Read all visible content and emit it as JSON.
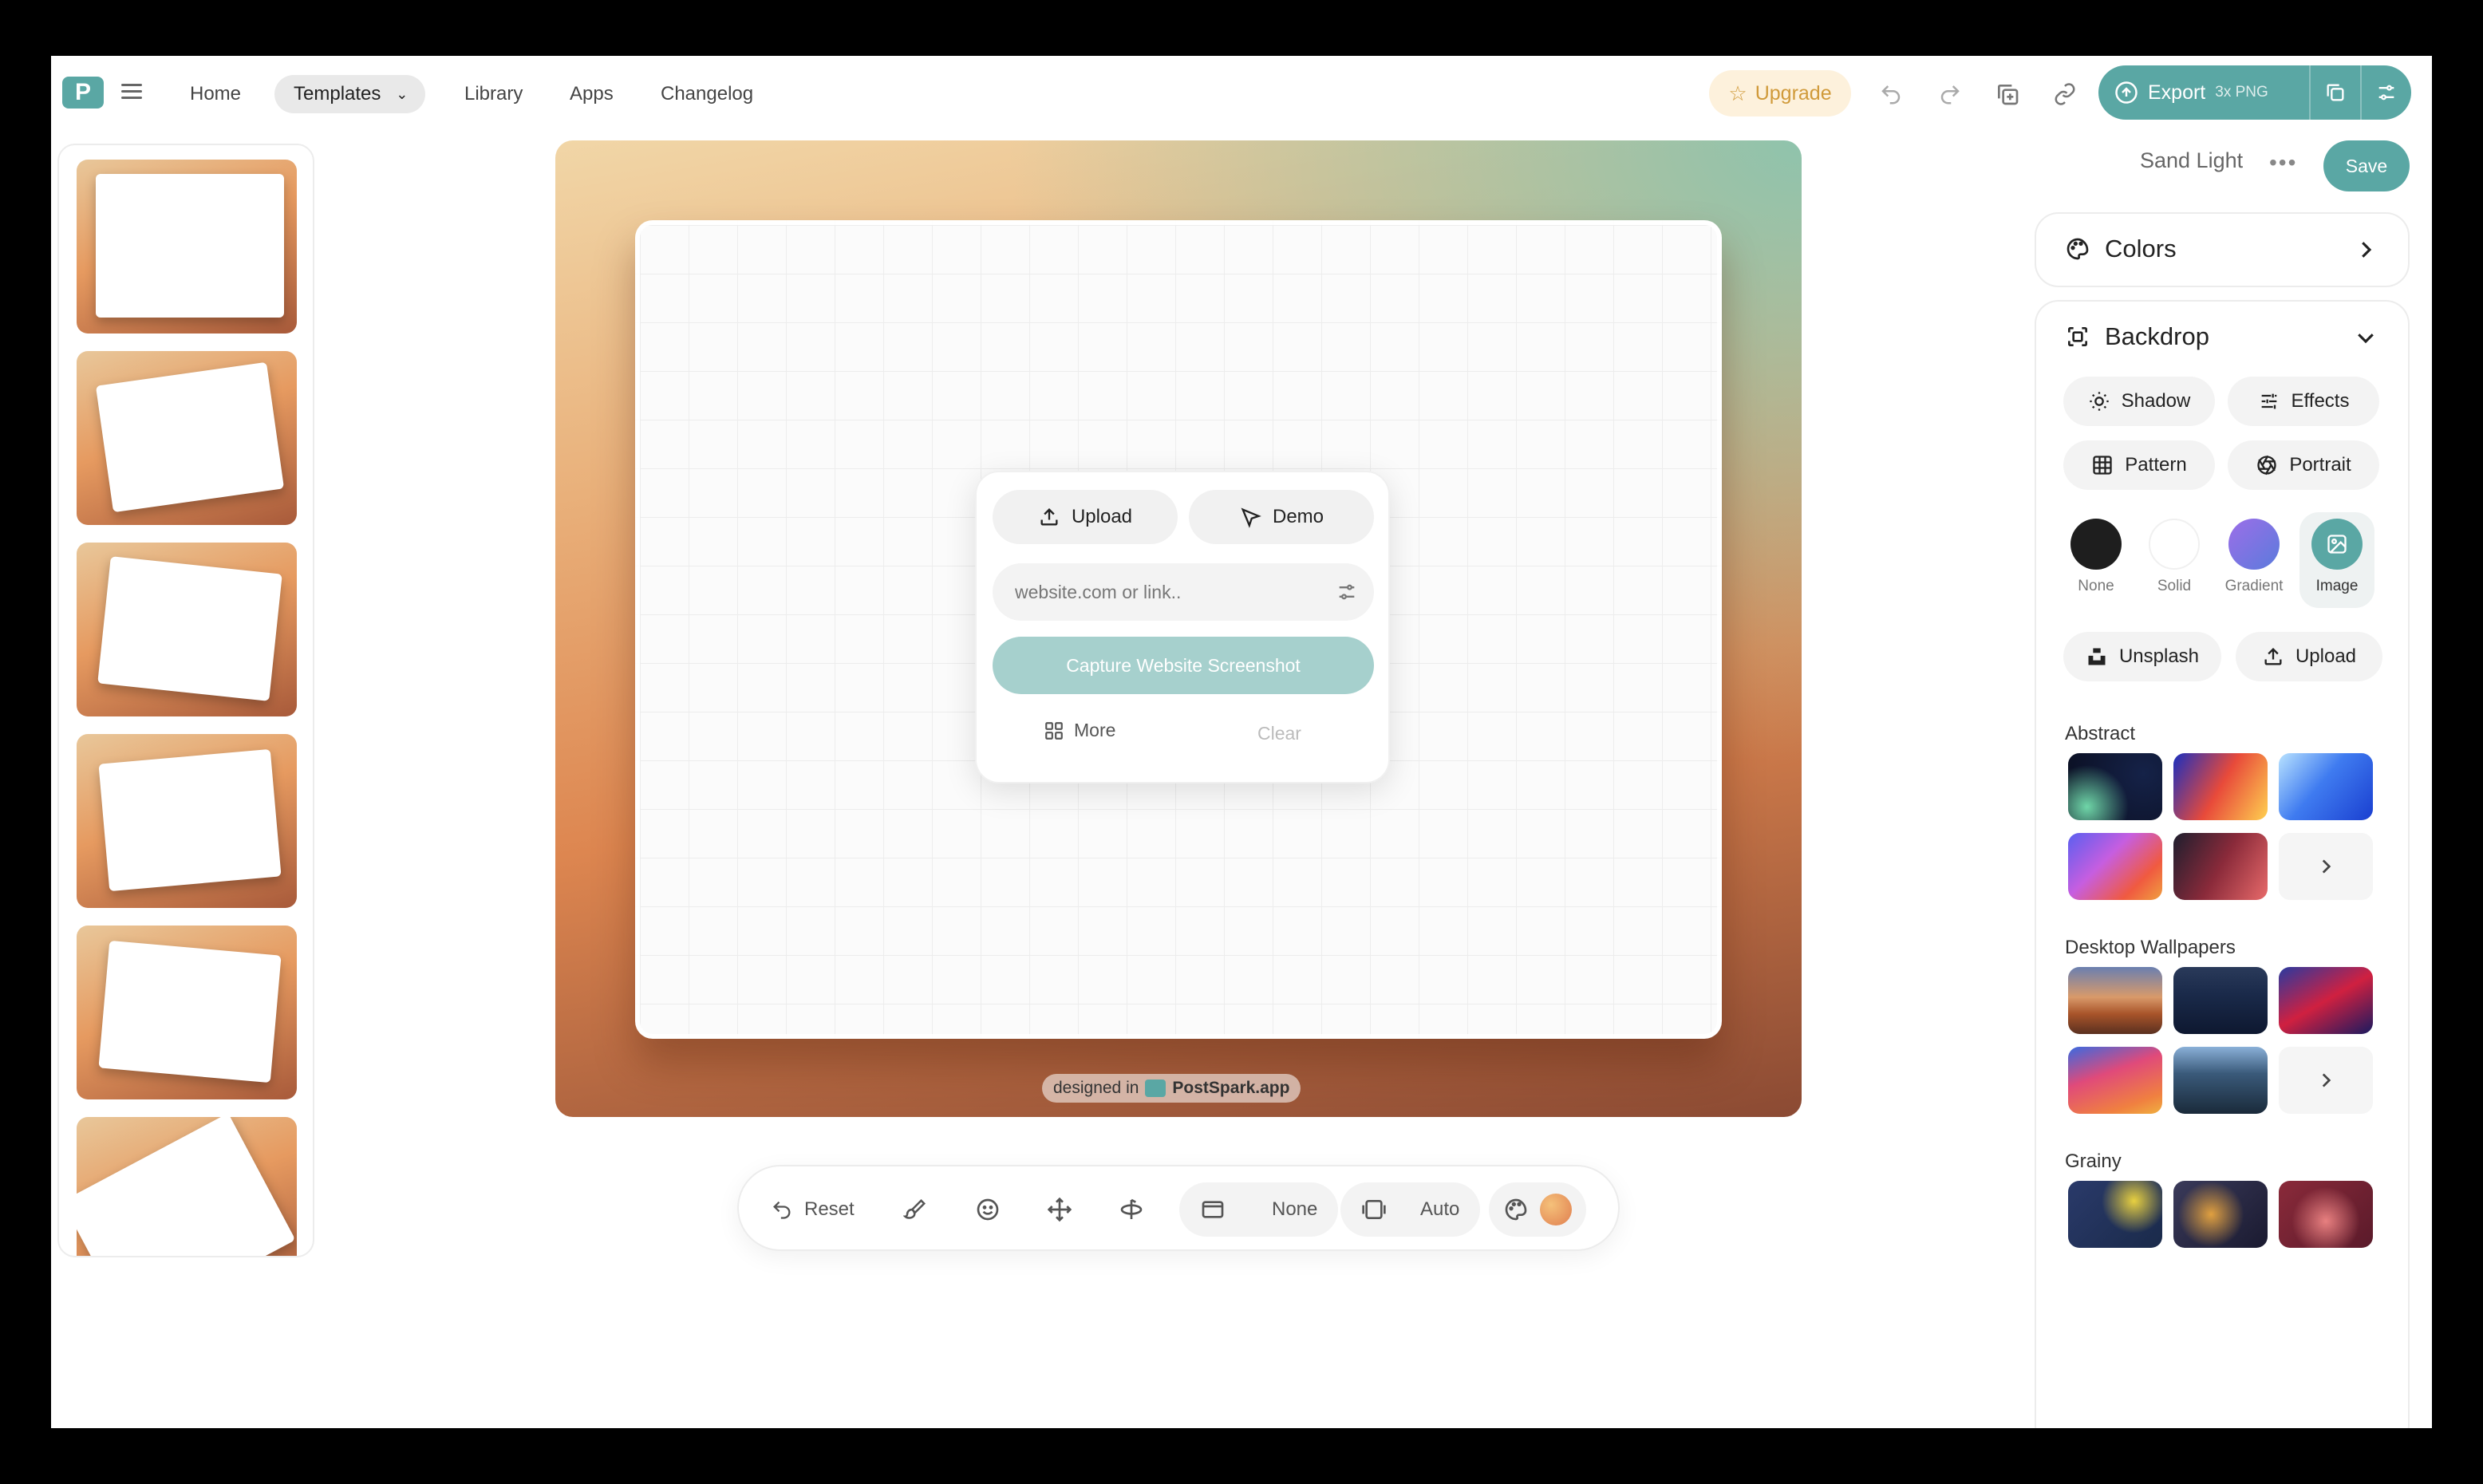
{
  "nav": {
    "logo_text": "P",
    "items": [
      {
        "label": "Home"
      },
      {
        "label": "Templates",
        "active": true
      },
      {
        "label": "Library"
      },
      {
        "label": "Apps"
      },
      {
        "label": "Changelog"
      }
    ]
  },
  "header": {
    "upgrade_label": "Upgrade",
    "export_label": "Export",
    "export_sub": "3x PNG",
    "accent_color": "#5aa7a4"
  },
  "canvas": {
    "watermark_prefix": "designed in",
    "watermark_brand": "PostSpark.app"
  },
  "popover": {
    "upload_label": "Upload",
    "demo_label": "Demo",
    "url_placeholder": "website.com or link..",
    "capture_label": "Capture Website Screenshot",
    "more_label": "More",
    "clear_label": "Clear"
  },
  "toolbar": {
    "reset_label": "Reset",
    "frame_value": "None",
    "auto_value": "Auto"
  },
  "panel": {
    "preset_name": "Sand Light",
    "save_label": "Save",
    "colors_title": "Colors",
    "backdrop_title": "Backdrop",
    "options": [
      "Shadow",
      "Effects",
      "Pattern",
      "Portrait"
    ],
    "fill_types": [
      "None",
      "Solid",
      "Gradient",
      "Image"
    ],
    "selected_fill": "Image",
    "unsplash_label": "Unsplash",
    "upload_label": "Upload",
    "sections": [
      "Abstract",
      "Desktop Wallpapers",
      "Grainy"
    ]
  }
}
